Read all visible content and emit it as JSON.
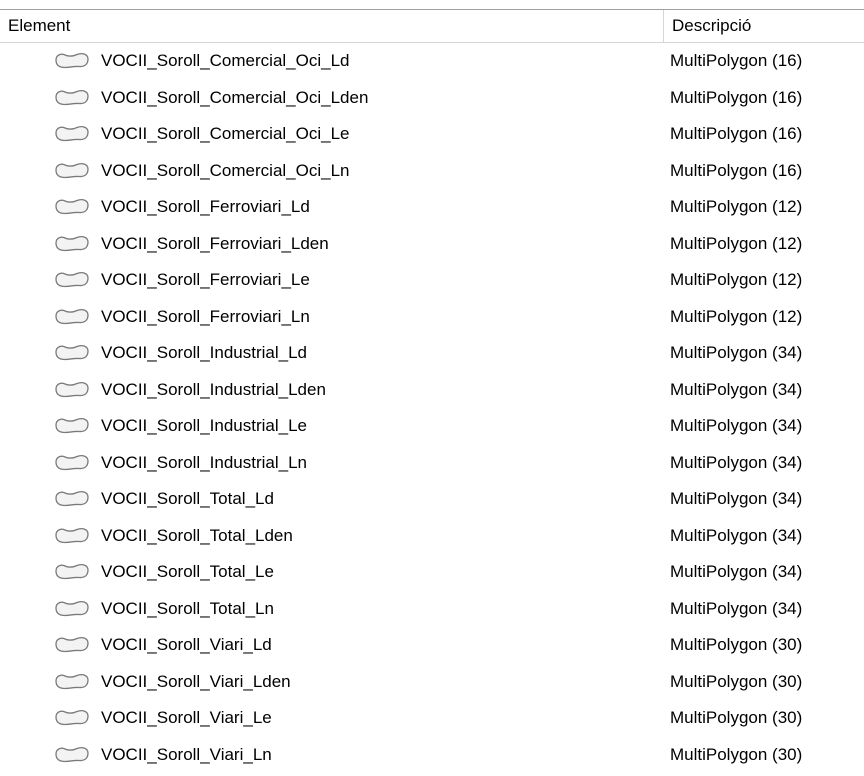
{
  "header": {
    "element_label": "Element",
    "description_label": "Descripció"
  },
  "icon": "polygon-layer-icon",
  "rows": [
    {
      "name": "VOCII_Soroll_Comercial_Oci_Ld",
      "desc": "MultiPolygon (16)"
    },
    {
      "name": "VOCII_Soroll_Comercial_Oci_Lden",
      "desc": "MultiPolygon (16)"
    },
    {
      "name": "VOCII_Soroll_Comercial_Oci_Le",
      "desc": "MultiPolygon (16)"
    },
    {
      "name": "VOCII_Soroll_Comercial_Oci_Ln",
      "desc": "MultiPolygon (16)"
    },
    {
      "name": "VOCII_Soroll_Ferroviari_Ld",
      "desc": "MultiPolygon (12)"
    },
    {
      "name": "VOCII_Soroll_Ferroviari_Lden",
      "desc": "MultiPolygon (12)"
    },
    {
      "name": "VOCII_Soroll_Ferroviari_Le",
      "desc": "MultiPolygon (12)"
    },
    {
      "name": "VOCII_Soroll_Ferroviari_Ln",
      "desc": "MultiPolygon (12)"
    },
    {
      "name": "VOCII_Soroll_Industrial_Ld",
      "desc": "MultiPolygon (34)"
    },
    {
      "name": "VOCII_Soroll_Industrial_Lden",
      "desc": "MultiPolygon (34)"
    },
    {
      "name": "VOCII_Soroll_Industrial_Le",
      "desc": "MultiPolygon (34)"
    },
    {
      "name": "VOCII_Soroll_Industrial_Ln",
      "desc": "MultiPolygon (34)"
    },
    {
      "name": "VOCII_Soroll_Total_Ld",
      "desc": "MultiPolygon (34)"
    },
    {
      "name": "VOCII_Soroll_Total_Lden",
      "desc": "MultiPolygon (34)"
    },
    {
      "name": "VOCII_Soroll_Total_Le",
      "desc": "MultiPolygon (34)"
    },
    {
      "name": "VOCII_Soroll_Total_Ln",
      "desc": "MultiPolygon (34)"
    },
    {
      "name": "VOCII_Soroll_Viari_Ld",
      "desc": "MultiPolygon (30)"
    },
    {
      "name": "VOCII_Soroll_Viari_Lden",
      "desc": "MultiPolygon (30)"
    },
    {
      "name": "VOCII_Soroll_Viari_Le",
      "desc": "MultiPolygon (30)"
    },
    {
      "name": "VOCII_Soroll_Viari_Ln",
      "desc": "MultiPolygon (30)"
    }
  ]
}
